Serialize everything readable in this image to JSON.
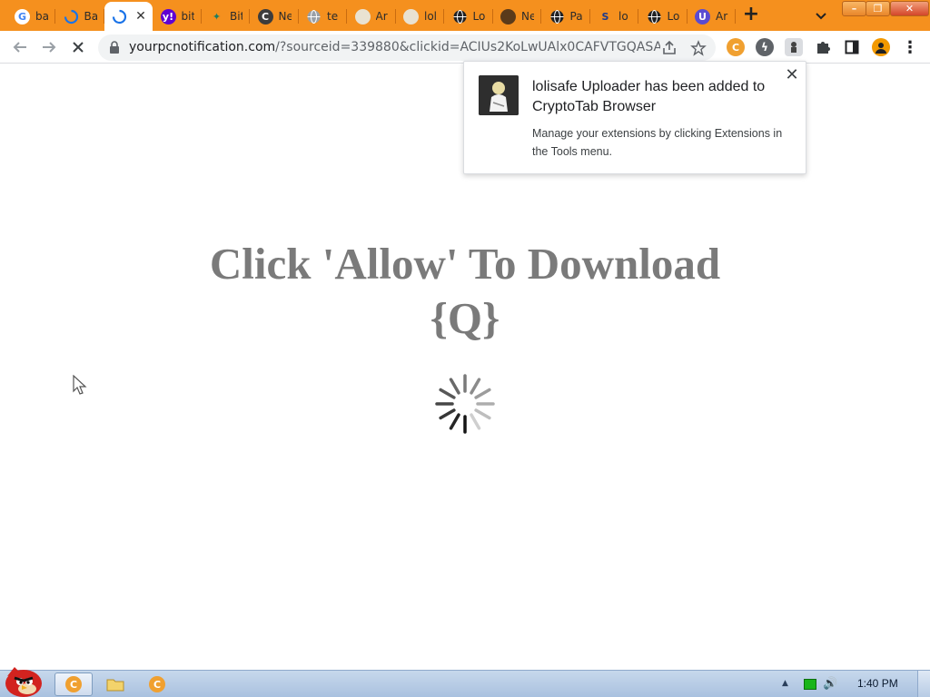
{
  "tabs": [
    {
      "label": "ba",
      "icon": "google-icon",
      "icon_text": "G",
      "icon_bg": "#ffffff",
      "icon_color": "#4285f4"
    },
    {
      "label": "Ba",
      "icon": "loading-arc-icon",
      "icon_text": "",
      "icon_bg": "transparent",
      "icon_color": "#1a73e8"
    },
    {
      "label": "",
      "icon": "loading-spinner-icon",
      "icon_text": "",
      "icon_bg": "transparent",
      "icon_color": "#1a73e8",
      "active": true
    },
    {
      "label": "bit",
      "icon": "yahoo-icon",
      "icon_text": "y!",
      "icon_bg": "#6001d2",
      "icon_color": "#ffffff"
    },
    {
      "label": "Bit",
      "icon": "bird-icon",
      "icon_text": "✦",
      "icon_bg": "transparent",
      "icon_color": "#1e7d63"
    },
    {
      "label": "Ne",
      "icon": "cryptotab-icon",
      "icon_text": "C",
      "icon_bg": "#3c3c3c",
      "icon_color": "#ffffff"
    },
    {
      "label": "te",
      "icon": "globe-icon",
      "icon_text": "",
      "icon_bg": "#9aa0a6",
      "icon_color": "#ffffff"
    },
    {
      "label": "Ar",
      "icon": "image-icon",
      "icon_text": "",
      "icon_bg": "#e9e2d2",
      "icon_color": "#b55"
    },
    {
      "label": "lol",
      "icon": "image-icon",
      "icon_text": "",
      "icon_bg": "#e9e2d2",
      "icon_color": "#b55"
    },
    {
      "label": "Lo",
      "icon": "globe-icon",
      "icon_text": "",
      "icon_bg": "#202124",
      "icon_color": "#ffffff"
    },
    {
      "label": "Ne",
      "icon": "avatar-icon",
      "icon_text": "",
      "icon_bg": "#5a3a1a",
      "icon_color": "#ffffff"
    },
    {
      "label": "Pa",
      "icon": "globe-icon",
      "icon_text": "",
      "icon_bg": "#202124",
      "icon_color": "#ffffff"
    },
    {
      "label": "lo",
      "icon": "s-logo-icon",
      "icon_text": "S",
      "icon_bg": "transparent",
      "icon_color": "#1f3b8c"
    },
    {
      "label": "Lo",
      "icon": "globe-icon",
      "icon_text": "",
      "icon_bg": "#202124",
      "icon_color": "#ffffff"
    },
    {
      "label": "Ar",
      "icon": "u-logo-icon",
      "icon_text": "U",
      "icon_bg": "#5a4bd1",
      "icon_color": "#ffffff"
    }
  ],
  "toolbar": {
    "url_domain": "yourpcnotification.com",
    "url_rest": "/?sourceid=339880&clickid=ACIUs2KoLwUAlx0CAFVTGQASA..."
  },
  "page": {
    "headline_line1": "Click 'Allow' To Download",
    "headline_line2": "{Q}"
  },
  "popup": {
    "title": "lolisafe Uploader has been added to CryptoTab Browser",
    "message": "Manage your extensions by clicking Extensions in the Tools menu."
  },
  "taskbar": {
    "clock": "1:40 PM"
  },
  "colors": {
    "tabstrip": "#f5901e",
    "headline": "#7a7a7a",
    "taskbar": "#b8cde6"
  }
}
